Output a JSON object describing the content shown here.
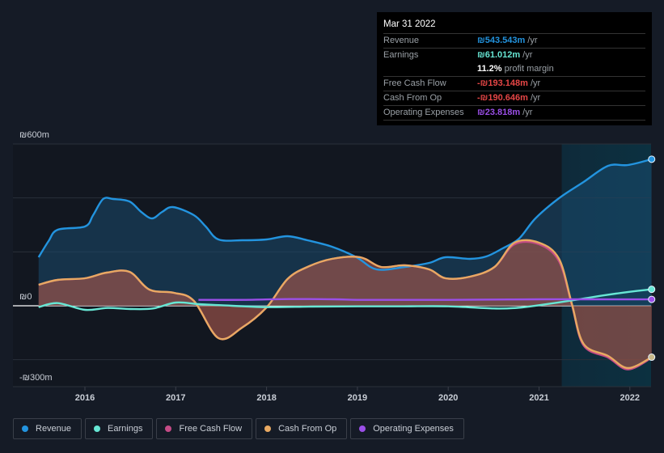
{
  "tooltip": {
    "date": "Mar 31 2022",
    "rows": [
      {
        "label": "Revenue",
        "value": "₪543.543m",
        "unit": "/yr",
        "color": "#2394df"
      },
      {
        "label": "Earnings",
        "value": "₪61.012m",
        "unit": "/yr",
        "color": "#67e6d4"
      },
      {
        "label": "",
        "value": "11.2%",
        "unit": "profit margin",
        "color": "#ffffff"
      },
      {
        "label": "Free Cash Flow",
        "value": "-₪193.148m",
        "unit": "/yr",
        "color": "#e64646"
      },
      {
        "label": "Cash From Op",
        "value": "-₪190.646m",
        "unit": "/yr",
        "color": "#e64646"
      },
      {
        "label": "Operating Expenses",
        "value": "₪23.818m",
        "unit": "/yr",
        "color": "#9b4fe8"
      }
    ]
  },
  "legend": [
    {
      "label": "Revenue",
      "color": "#2394df"
    },
    {
      "label": "Earnings",
      "color": "#67e6d4"
    },
    {
      "label": "Free Cash Flow",
      "color": "#c44b86"
    },
    {
      "label": "Cash From Op",
      "color": "#e8a962"
    },
    {
      "label": "Operating Expenses",
      "color": "#9b4fe8"
    }
  ],
  "chart_data": {
    "type": "area",
    "title": "",
    "xlabel": "",
    "ylabel": "",
    "currency": "₪",
    "ylim": [
      -300,
      600
    ],
    "xlim": [
      2015.49,
      2022.25
    ],
    "y_tick_labels": [
      {
        "value": 600,
        "label": "₪600m"
      },
      {
        "value": 0,
        "label": "₪0"
      },
      {
        "value": -300,
        "label": "-₪300m"
      }
    ],
    "gridlines": [
      600,
      400,
      200,
      0,
      -200,
      -300
    ],
    "x_ticks": [
      2016,
      2017,
      2018,
      2019,
      2020,
      2021,
      2022
    ],
    "highlight_start": 2021.25,
    "series": [
      {
        "name": "Revenue",
        "color": "#2394df",
        "points": [
          [
            2015.49,
            180
          ],
          [
            2015.6,
            240
          ],
          [
            2015.7,
            282
          ],
          [
            2016.0,
            294
          ],
          [
            2016.09,
            336
          ],
          [
            2016.2,
            396
          ],
          [
            2016.31,
            396
          ],
          [
            2016.49,
            387
          ],
          [
            2016.62,
            348
          ],
          [
            2016.74,
            324
          ],
          [
            2016.85,
            348
          ],
          [
            2016.97,
            366
          ],
          [
            2017.2,
            336
          ],
          [
            2017.33,
            294
          ],
          [
            2017.47,
            246
          ],
          [
            2017.73,
            243
          ],
          [
            2018.0,
            246
          ],
          [
            2018.23,
            258
          ],
          [
            2018.45,
            243
          ],
          [
            2018.72,
            219
          ],
          [
            2018.99,
            180
          ],
          [
            2019.21,
            135
          ],
          [
            2019.52,
            144
          ],
          [
            2019.79,
            159
          ],
          [
            2019.97,
            180
          ],
          [
            2020.24,
            174
          ],
          [
            2020.42,
            183
          ],
          [
            2020.6,
            213
          ],
          [
            2020.78,
            249
          ],
          [
            2020.96,
            324
          ],
          [
            2021.22,
            399
          ],
          [
            2021.49,
            459
          ],
          [
            2021.76,
            519
          ],
          [
            2021.98,
            522
          ],
          [
            2022.24,
            543.5
          ]
        ]
      },
      {
        "name": "Earnings",
        "color": "#67e6d4",
        "points": [
          [
            2015.49,
            -5
          ],
          [
            2015.7,
            10
          ],
          [
            2016.0,
            -15
          ],
          [
            2016.25,
            -8
          ],
          [
            2016.5,
            -12
          ],
          [
            2016.75,
            -10
          ],
          [
            2017.0,
            12
          ],
          [
            2017.25,
            6
          ],
          [
            2017.5,
            2
          ],
          [
            2018.0,
            -5
          ],
          [
            2018.5,
            -3
          ],
          [
            2019.0,
            -2
          ],
          [
            2019.5,
            -2
          ],
          [
            2020.0,
            -2
          ],
          [
            2020.5,
            -10
          ],
          [
            2020.75,
            -8
          ],
          [
            2021.0,
            2
          ],
          [
            2021.4,
            22
          ],
          [
            2021.7,
            38
          ],
          [
            2022.0,
            52
          ],
          [
            2022.24,
            61
          ]
        ]
      },
      {
        "name": "Free Cash Flow",
        "color": "#c44b86",
        "points": [
          [
            2015.49,
            78
          ],
          [
            2015.7,
            96
          ],
          [
            2016.0,
            102
          ],
          [
            2016.24,
            123
          ],
          [
            2016.49,
            126
          ],
          [
            2016.71,
            60
          ],
          [
            2016.98,
            48
          ],
          [
            2017.2,
            18
          ],
          [
            2017.47,
            -120
          ],
          [
            2017.73,
            -81
          ],
          [
            2018.0,
            -6
          ],
          [
            2018.23,
            99
          ],
          [
            2018.45,
            144
          ],
          [
            2018.72,
            174
          ],
          [
            2019.03,
            180
          ],
          [
            2019.26,
            144
          ],
          [
            2019.52,
            150
          ],
          [
            2019.79,
            135
          ],
          [
            2019.97,
            102
          ],
          [
            2020.24,
            108
          ],
          [
            2020.51,
            144
          ],
          [
            2020.73,
            228
          ],
          [
            2021.0,
            228
          ],
          [
            2021.22,
            165
          ],
          [
            2021.36,
            5
          ],
          [
            2021.49,
            -147
          ],
          [
            2021.76,
            -192
          ],
          [
            2021.98,
            -236
          ],
          [
            2022.24,
            -193
          ]
        ]
      },
      {
        "name": "Cash From Op",
        "color": "#e8a962",
        "points": [
          [
            2015.49,
            78
          ],
          [
            2015.7,
            96
          ],
          [
            2016.0,
            102
          ],
          [
            2016.24,
            123
          ],
          [
            2016.49,
            126
          ],
          [
            2016.71,
            60
          ],
          [
            2016.98,
            48
          ],
          [
            2017.2,
            18
          ],
          [
            2017.47,
            -120
          ],
          [
            2017.73,
            -81
          ],
          [
            2018.0,
            -6
          ],
          [
            2018.23,
            99
          ],
          [
            2018.45,
            144
          ],
          [
            2018.72,
            174
          ],
          [
            2019.03,
            180
          ],
          [
            2019.26,
            144
          ],
          [
            2019.52,
            150
          ],
          [
            2019.79,
            135
          ],
          [
            2019.97,
            102
          ],
          [
            2020.24,
            108
          ],
          [
            2020.51,
            144
          ],
          [
            2020.73,
            234
          ],
          [
            2021.0,
            234
          ],
          [
            2021.22,
            174
          ],
          [
            2021.36,
            9
          ],
          [
            2021.49,
            -141
          ],
          [
            2021.76,
            -186
          ],
          [
            2021.98,
            -231
          ],
          [
            2022.24,
            -190.6
          ]
        ]
      },
      {
        "name": "Operating Expenses",
        "color": "#9b4fe8",
        "points": [
          [
            2017.25,
            22
          ],
          [
            2017.75,
            22
          ],
          [
            2018.25,
            25
          ],
          [
            2018.75,
            24
          ],
          [
            2019.0,
            22
          ],
          [
            2019.5,
            22
          ],
          [
            2020.0,
            22
          ],
          [
            2020.5,
            23
          ],
          [
            2021.0,
            24
          ],
          [
            2021.5,
            24
          ],
          [
            2022.24,
            23.8
          ]
        ]
      }
    ]
  }
}
